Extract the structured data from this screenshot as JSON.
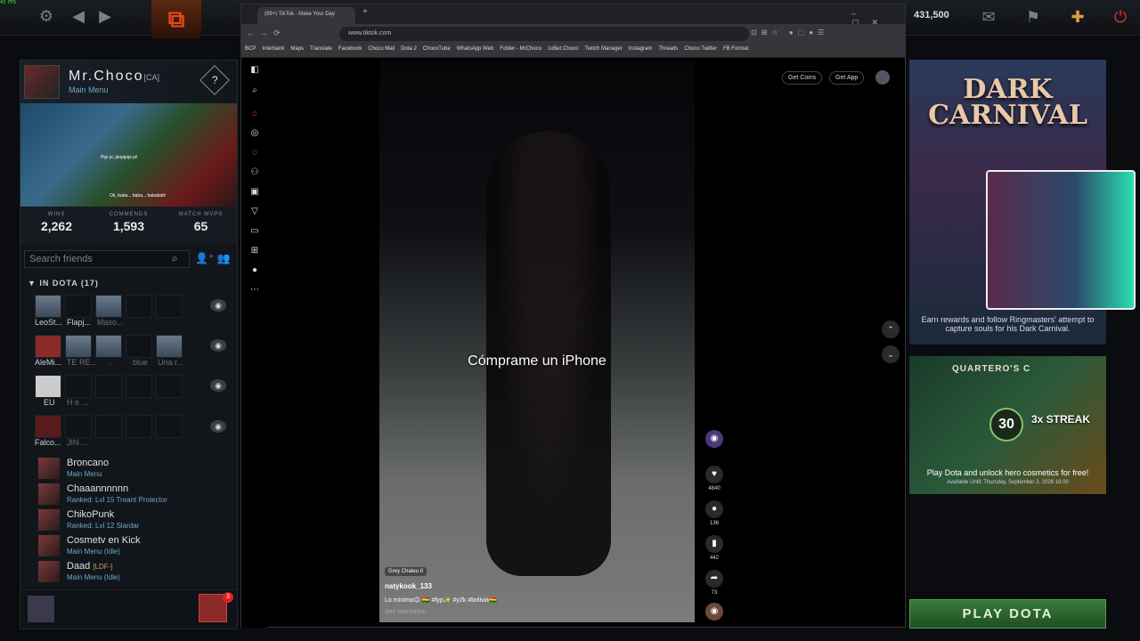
{
  "fps": "43 FPS",
  "topbar": {
    "coins": "431,500"
  },
  "profile": {
    "name": "Mr.Choco",
    "tag": "[CA]",
    "status": "Main Menu",
    "bubble1": "Pipi pi, piripipipi pi!",
    "bubble2": "Ok, baba... baba... bababab!"
  },
  "stats": [
    {
      "label": "WINS",
      "value": "2,262"
    },
    {
      "label": "COMMENDS",
      "value": "1,593"
    },
    {
      "label": "MATCH MVPS",
      "value": "65"
    }
  ],
  "search": {
    "placeholder": "Search friends"
  },
  "group": {
    "title": "IN DOTA (17)"
  },
  "slot_labels": [
    "LeoSt...",
    "Flapj...",
    "Maso...",
    "AleMi...",
    "TE RE...",
    ".",
    "blue",
    "Una r...",
    "EU",
    "H e ...",
    "Falco...",
    "JIN ..."
  ],
  "friends": [
    {
      "name": "Broncano",
      "status": "Main Menu"
    },
    {
      "name": "Chaaannnnnn",
      "status": "Ranked: Lvl 15 Treant Protector"
    },
    {
      "name": "ChikoPunk",
      "status": "Ranked: Lvl 12 Slardar"
    },
    {
      "name": "Cosmetv en Kick",
      "status": "Main Menu (Idle)"
    },
    {
      "name": "Daad",
      "rank": "[LDF-]",
      "status": "Main Menu (Idle)"
    }
  ],
  "notif_count": "3",
  "browser": {
    "tab_title": "(99+) TikTok - Make Your Day",
    "url": "www.tiktok.com",
    "bookmarks": [
      "BCP",
      "Interbank",
      "Maps",
      "Translate",
      "Facebook",
      "Choco Mail",
      "Dota 2",
      "ChocoTube",
      "WhatsApp Web",
      "Folder - MrChoco",
      "1xBet Choco",
      "Twitch Manager",
      "Instagram",
      "Threads",
      "Choco Twitter",
      "FB Format"
    ]
  },
  "tiktok": {
    "get_coins": "Get Coins",
    "get_app": "Get App",
    "caption": "Cómprame un iPhone",
    "sound": "Grey Chateu II",
    "author": "natykook_133",
    "description": "Lo mínimo😉 🇧🇴 #fyp✨ #y2k #bolivia🇧🇴",
    "see_translation": "See translation",
    "likes": "4840",
    "comments": "136",
    "saves": "442",
    "shares": "73"
  },
  "carnival": {
    "title1": "DARK",
    "title2": "CARNIVAL",
    "desc": "Earn rewards and follow Ringmasters' attempt to capture souls for his Dark Carnival."
  },
  "quartero": {
    "title": "QUARTERO'S C",
    "number": "30",
    "streak": "3x STREAK",
    "desc": "Play Dota and unlock hero cosmetics for free!",
    "avail": "Available Until: Thursday, September 3, 2026 18:00"
  },
  "play": "PLAY DOTA"
}
